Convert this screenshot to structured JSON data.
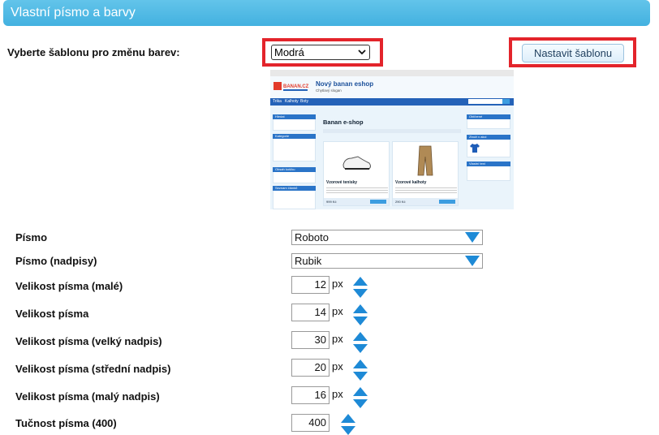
{
  "header": {
    "title": "Vlastní písmo a barvy"
  },
  "template": {
    "label": "Vyberte šablonu pro změnu barev:",
    "selected": "Modrá",
    "button_label": "Nastavit šablonu"
  },
  "preview": {
    "shop_name": "Nový banan eshop",
    "slogan": "Chytlavý slogan",
    "logo_text": "BANAN.CZ",
    "nav": [
      "Trika",
      "Kalhoty",
      "Boty"
    ],
    "search_placeholder": "Hledat",
    "search_button": "OK",
    "left_boxes": [
      "Hledat",
      "Kategorie",
      "Obsah košíku",
      "Seznam článků"
    ],
    "categories": [
      "Trika",
      "Kalhoty",
      "Boty"
    ],
    "main_title": "Banan e-shop",
    "products": [
      {
        "name": "Vzorové tenisky",
        "price": "999 Kč"
      },
      {
        "name": "Vzorové kalhoty",
        "price": "290 Kč"
      }
    ],
    "right_boxes": [
      "Oblíbené",
      "Zboží v akci",
      "Vlastní text"
    ],
    "colors": {
      "nav": "#2462b8",
      "box_head": "#2a74c8",
      "button": "#3c9de0"
    }
  },
  "settings": {
    "font_label": "Písmo",
    "font_value": "Roboto",
    "heading_font_label": "Písmo (nadpisy)",
    "heading_font_value": "Rubik",
    "size_small_label": "Velikost písma (malé)",
    "size_small_value": "12",
    "size_label": "Velikost písma",
    "size_value": "14",
    "size_big_heading_label": "Velikost písma (velký nadpis)",
    "size_big_heading_value": "30",
    "size_mid_heading_label": "Velikost písma (střední nadpis)",
    "size_mid_heading_value": "20",
    "size_small_heading_label": "Velikost písma (malý nadpis)",
    "size_small_heading_value": "16",
    "weight_label": "Tučnost písma (400)",
    "weight_value": "400",
    "unit": "px"
  },
  "colors": {
    "header": "#4ab5e3",
    "highlight": "#e3242b",
    "spinner": "#1e8ad6"
  }
}
